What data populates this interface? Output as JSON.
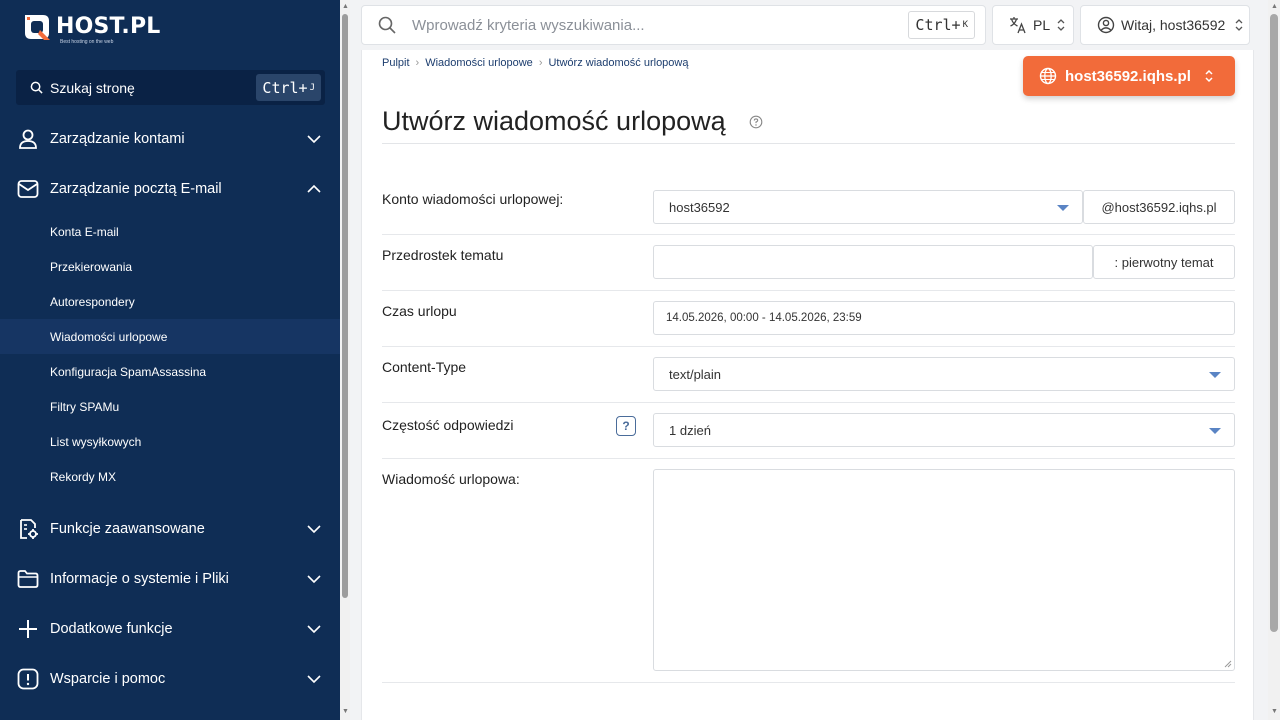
{
  "brand": {
    "name": "HOST.PL",
    "tagline": "Best hosting on the web"
  },
  "sidebar": {
    "search": {
      "label": "Szukaj stronę",
      "shortcut_key": "Ctrl+",
      "shortcut_letter": "J"
    },
    "sections": [
      {
        "label": "Zarządzanie kontami",
        "icon": "user-icon",
        "expanded": false
      },
      {
        "label": "Zarządzanie pocztą E-mail",
        "icon": "mail-icon",
        "expanded": true
      },
      {
        "label": "Funkcje zaawansowane",
        "icon": "settings-doc-icon",
        "expanded": false
      },
      {
        "label": "Informacje o systemie i Pliki",
        "icon": "folder-icon",
        "expanded": false
      },
      {
        "label": "Dodatkowe funkcje",
        "icon": "plus-icon",
        "expanded": false
      },
      {
        "label": "Wsparcie i pomoc",
        "icon": "alert-icon",
        "expanded": false
      }
    ],
    "email_items": [
      {
        "label": "Konta E-mail"
      },
      {
        "label": "Przekierowania"
      },
      {
        "label": "Autorespondery"
      },
      {
        "label": "Wiadomości urlopowe",
        "active": true
      },
      {
        "label": "Konfiguracja SpamAssassina"
      },
      {
        "label": "Filtry SPAMu"
      },
      {
        "label": "List wysyłkowych"
      },
      {
        "label": "Rekordy MX"
      }
    ]
  },
  "topbar": {
    "search_placeholder": "Wprowadź kryteria wyszukiwania...",
    "shortcut_key": "Ctrl+",
    "shortcut_letter": "K",
    "language": "PL",
    "user_greeting": "Witaj, host36592"
  },
  "breadcrumb": [
    "Pulpit",
    "Wiadomości urlopowe",
    "Utwórz wiadomość urlopową"
  ],
  "domain_selector": "host36592.iqhs.pl",
  "page_title": "Utwórz wiadomość urlopową",
  "form": {
    "account": {
      "label": "Konto wiadomości urlopowej:",
      "value": "host36592",
      "suffix": "@host36592.iqhs.pl"
    },
    "subject_prefix": {
      "label": "Przedrostek tematu",
      "value": "",
      "suffix": ": pierwotny temat"
    },
    "vacation_time": {
      "label": "Czas urlopu",
      "value": "14.05.2026, 00:00 - 14.05.2026, 23:59"
    },
    "content_type": {
      "label": "Content-Type",
      "value": "text/plain"
    },
    "reply_frequency": {
      "label": "Częstość odpowiedzi",
      "value": "1 dzień",
      "help": "?"
    },
    "message": {
      "label": "Wiadomość urlopowa:",
      "value": ""
    }
  },
  "colors": {
    "sidebar_bg": "#0f2d55",
    "accent": "#f26b3a",
    "link": "#1c3d6e"
  }
}
